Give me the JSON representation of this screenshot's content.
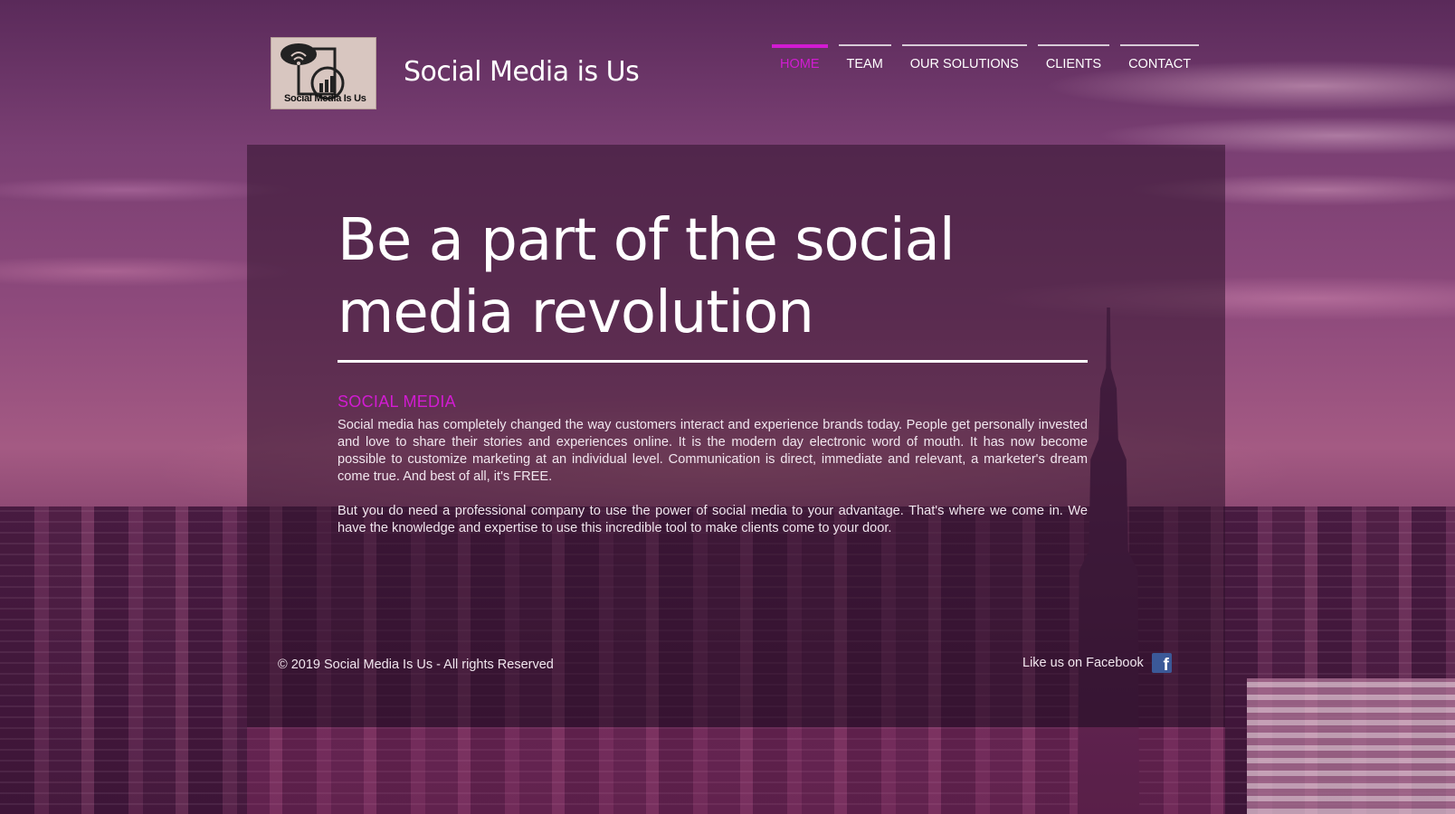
{
  "site": {
    "title": "Social Media is Us",
    "logo_text": "Social Media Is Us"
  },
  "nav": {
    "items": [
      {
        "label": "HOME",
        "active": true
      },
      {
        "label": "TEAM",
        "active": false
      },
      {
        "label": "OUR SOLUTIONS",
        "active": false
      },
      {
        "label": "CLIENTS",
        "active": false
      },
      {
        "label": "CONTACT",
        "active": false
      }
    ]
  },
  "hero": {
    "headline_line1": "Be a part of the social",
    "headline_line2": "media revolution"
  },
  "section": {
    "title": "SOCIAL MEDIA",
    "paragraph1": "Social media has completely changed the way customers interact and experience brands today. People get personally invested and love to share their stories and experiences online. It is the modern day electronic word of mouth. It has now become possible to customize marketing at an individual level. Communication is direct, immediate and relevant, a marketer's dream come true. And best of all, it's FREE.",
    "paragraph2": "But you do need a professional company to use the power of social media to your advantage. That's where we come in. We have the knowledge and expertise to use this incredible tool to make clients come to your door."
  },
  "footer": {
    "copyright": "© 2019 Social Media Is Us - All rights Reserved",
    "facebook_label": "Like us on Facebook",
    "facebook_icon": "facebook-icon"
  },
  "colors": {
    "accent": "#d21bd2",
    "facebook": "#3b5998"
  }
}
